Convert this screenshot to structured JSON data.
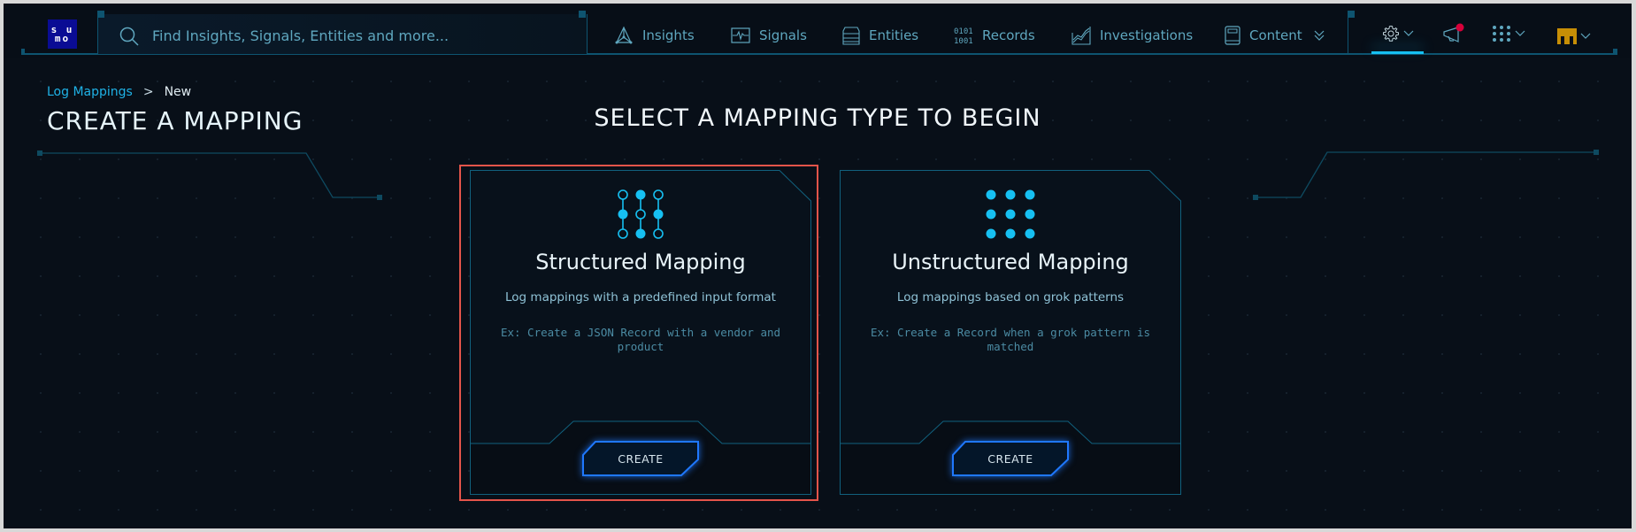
{
  "nav": {
    "logo_text_top": "s u",
    "logo_text_bottom": "mo",
    "search": {
      "placeholder": "Find Insights, Signals, Entities and more...",
      "icon": "search-icon"
    },
    "items": [
      {
        "label": "Insights",
        "icon": "insights-icon"
      },
      {
        "label": "Signals",
        "icon": "signals-icon"
      },
      {
        "label": "Entities",
        "icon": "entities-icon"
      },
      {
        "label": "Records",
        "icon": "records-icon"
      },
      {
        "label": "Investigations",
        "icon": "investigations-icon"
      },
      {
        "label": "Content",
        "icon": "content-icon"
      }
    ],
    "right_icons": [
      "gear-icon",
      "announcements-icon",
      "apps-grid-icon",
      "user-avatar"
    ],
    "active_right": "gear-icon",
    "notification_badge_color": "#d8003a",
    "avatar_color": "#c68e06"
  },
  "breadcrumb": {
    "parent": "Log Mappings",
    "separator": ">",
    "current": "New"
  },
  "page_title": "CREATE A MAPPING",
  "section_title": "SELECT A MAPPING TYPE TO BEGIN",
  "cards": [
    {
      "title": "Structured Mapping",
      "description": "Log mappings with a predefined input format",
      "example": "Ex: Create a JSON Record with a vendor and product",
      "button": "CREATE",
      "icon": "structured-mapping-icon",
      "selected": true
    },
    {
      "title": "Unstructured Mapping",
      "description": "Log mappings based on grok patterns",
      "example": "Ex: Create a Record when a grok pattern is matched",
      "button": "CREATE",
      "icon": "unstructured-mapping-icon",
      "selected": false
    }
  ],
  "colors": {
    "accent": "#1fb2e6",
    "frame": "#0e5470",
    "selection": "#e4544a",
    "button_glow": "#1e78ff"
  }
}
